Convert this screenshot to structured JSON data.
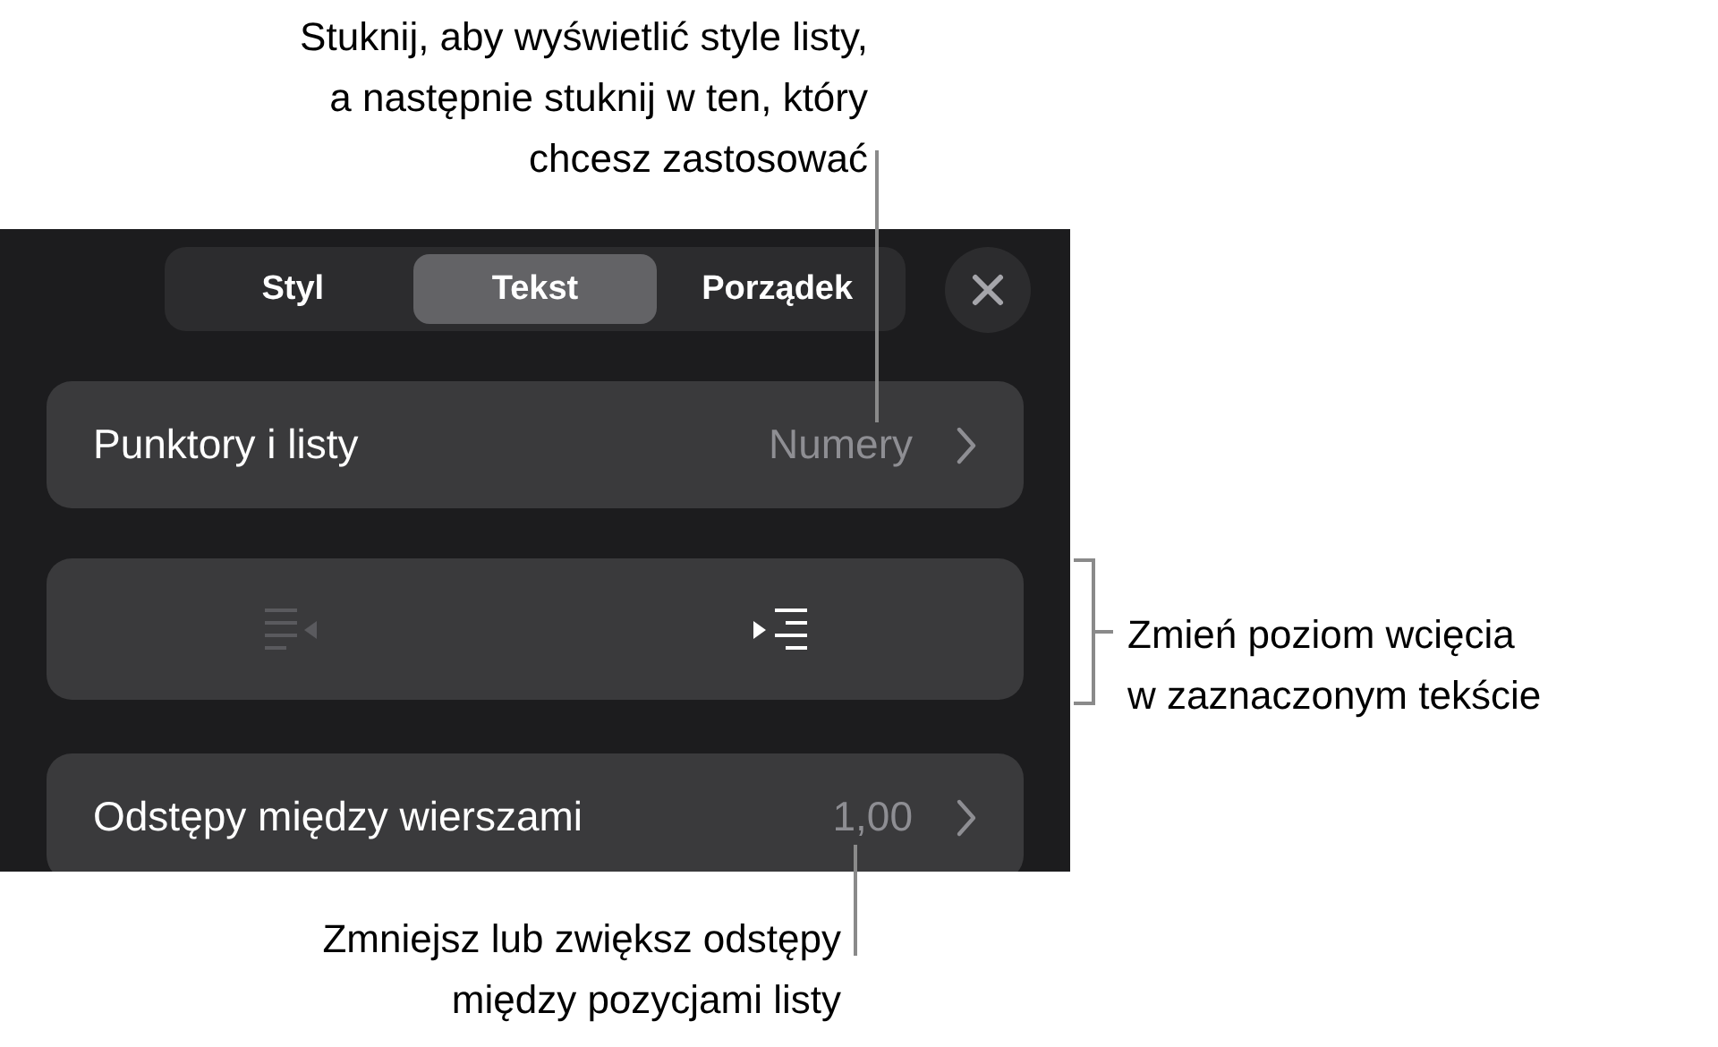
{
  "callouts": [
    {
      "kind": "top",
      "text": "Stuknij, aby wyświetlić style listy,\na następnie stuknij w ten, który\nchcesz zastosować"
    },
    {
      "kind": "right",
      "text": "Zmień poziom wcięcia\nw zaznaczonym tekście"
    },
    {
      "kind": "bottom",
      "text": "Zmniejsz lub zwiększ odstępy\nmiędzy pozycjami listy"
    }
  ],
  "tabs": [
    {
      "label": "Styl",
      "selected": false
    },
    {
      "label": "Tekst",
      "selected": true
    },
    {
      "label": "Porządek",
      "selected": false
    }
  ],
  "rows": [
    {
      "kind": "nav",
      "label": "Punktory i listy",
      "value": "Numery"
    },
    {
      "kind": "indent",
      "buttons": [
        {
          "kind": "outdent",
          "disabled": true
        },
        {
          "kind": "indent",
          "disabled": false
        }
      ]
    },
    {
      "kind": "nav",
      "label": "Odstępy między wierszami",
      "value": "1,00"
    }
  ]
}
